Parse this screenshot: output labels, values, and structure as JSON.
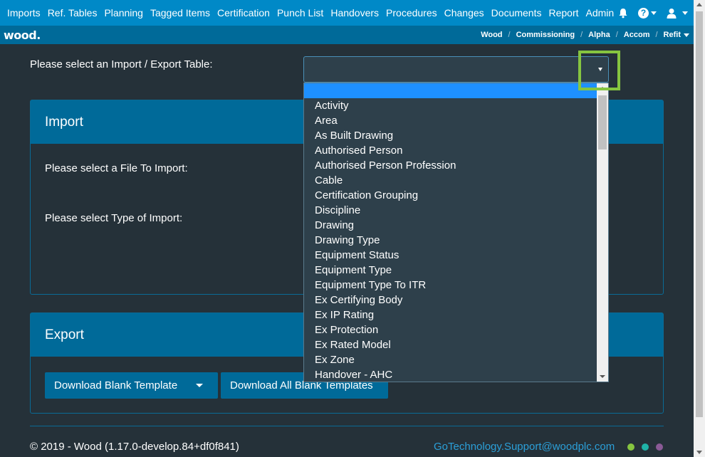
{
  "nav": {
    "items": [
      "Imports",
      "Ref. Tables",
      "Planning",
      "Tagged Items",
      "Certification",
      "Punch List",
      "Handovers",
      "Procedures",
      "Changes",
      "Documents",
      "Report",
      "Admin"
    ],
    "help_glyph": "?"
  },
  "logo": "wood.",
  "breadcrumbs": [
    "Wood",
    "Commissioning",
    "Alpha",
    "Accom",
    "Refit"
  ],
  "select": {
    "label": "Please select an Import / Export Table:",
    "value": ""
  },
  "import_panel": {
    "title": "Import",
    "file_label": "Please select a File To Import:",
    "type_label": "Please select Type of Import:"
  },
  "export_panel": {
    "title": "Export",
    "download_blank": "Download Blank Template",
    "download_all": "Download All Blank Templates"
  },
  "footer": {
    "copyright": "© 2019 - Wood (1.17.0-develop.84+df0f841)",
    "support_email": "GoTechnology.Support@woodplc.com",
    "dot_colors": [
      "#86c540",
      "#1fb3a8",
      "#8a5a96"
    ]
  },
  "dropdown_options": [
    "Activity",
    "Area",
    "As Built Drawing",
    "Authorised Person",
    "Authorised Person Profession",
    "Cable",
    "Certification Grouping",
    "Discipline",
    "Drawing",
    "Drawing Type",
    "Equipment Status",
    "Equipment Type",
    "Equipment Type To ITR",
    "Ex Certifying Body",
    "Ex IP Rating",
    "Ex Protection",
    "Ex Rated Model",
    "Ex Zone",
    "Handover - AHC"
  ],
  "colors": {
    "nav": "#0089c7",
    "subbar": "#006a99",
    "background": "#253139",
    "accent_highlight": "#86c540"
  }
}
